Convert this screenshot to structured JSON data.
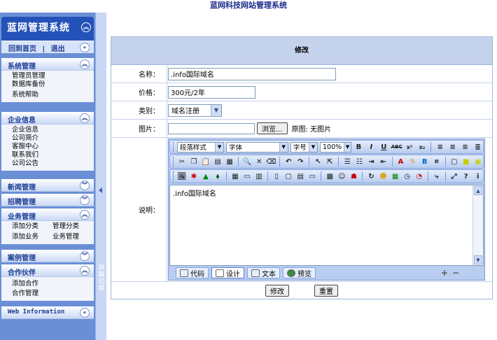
{
  "page_title": "蓝网科技网站管理系统",
  "sidebar": {
    "system_name": "蓝网管理系统",
    "home_link": "回到首页",
    "separator": "|",
    "logout_link": "退出",
    "groups": [
      {
        "title": "系统管理",
        "items": [
          "管理员管理",
          "数据库备份",
          "系统帮助"
        ]
      },
      {
        "title": "企业信息",
        "items": [
          "企业信息",
          "公司简介",
          "客服中心",
          "联系我们",
          "公司公告"
        ]
      },
      {
        "title": "新闻管理",
        "items": []
      },
      {
        "title": "招聘管理",
        "items": []
      },
      {
        "title": "业务管理",
        "items": [
          "添加分类",
          "管理分类",
          "添加业务",
          "业务管理"
        ]
      },
      {
        "title": "案例管理",
        "items": []
      },
      {
        "title": "合作伙伴",
        "items": [
          "添加合作",
          "合作管理"
        ]
      },
      {
        "title": "Web Information",
        "items": []
      }
    ],
    "toggle_label": "屏幕切换"
  },
  "form": {
    "header": "修改",
    "name_label": "名称：",
    "name_value": ".info国际域名",
    "price_label": "价格：",
    "price_value": "300元/2年",
    "category_label": "类别：",
    "category_value": "域名注册",
    "image_label": "图片：",
    "image_value": "",
    "browse_button": "浏览...",
    "image_hint": "原图: 无图片",
    "desc_label": "说明：",
    "editor": {
      "paragraph_style": "段落样式",
      "font": "字体",
      "font_size": "字号",
      "zoom": "100%",
      "content": ".info国际域名",
      "modes": [
        "代码",
        "设计",
        "文本",
        "预览"
      ]
    },
    "submit_button": "修改",
    "reset_button": "重置"
  }
}
